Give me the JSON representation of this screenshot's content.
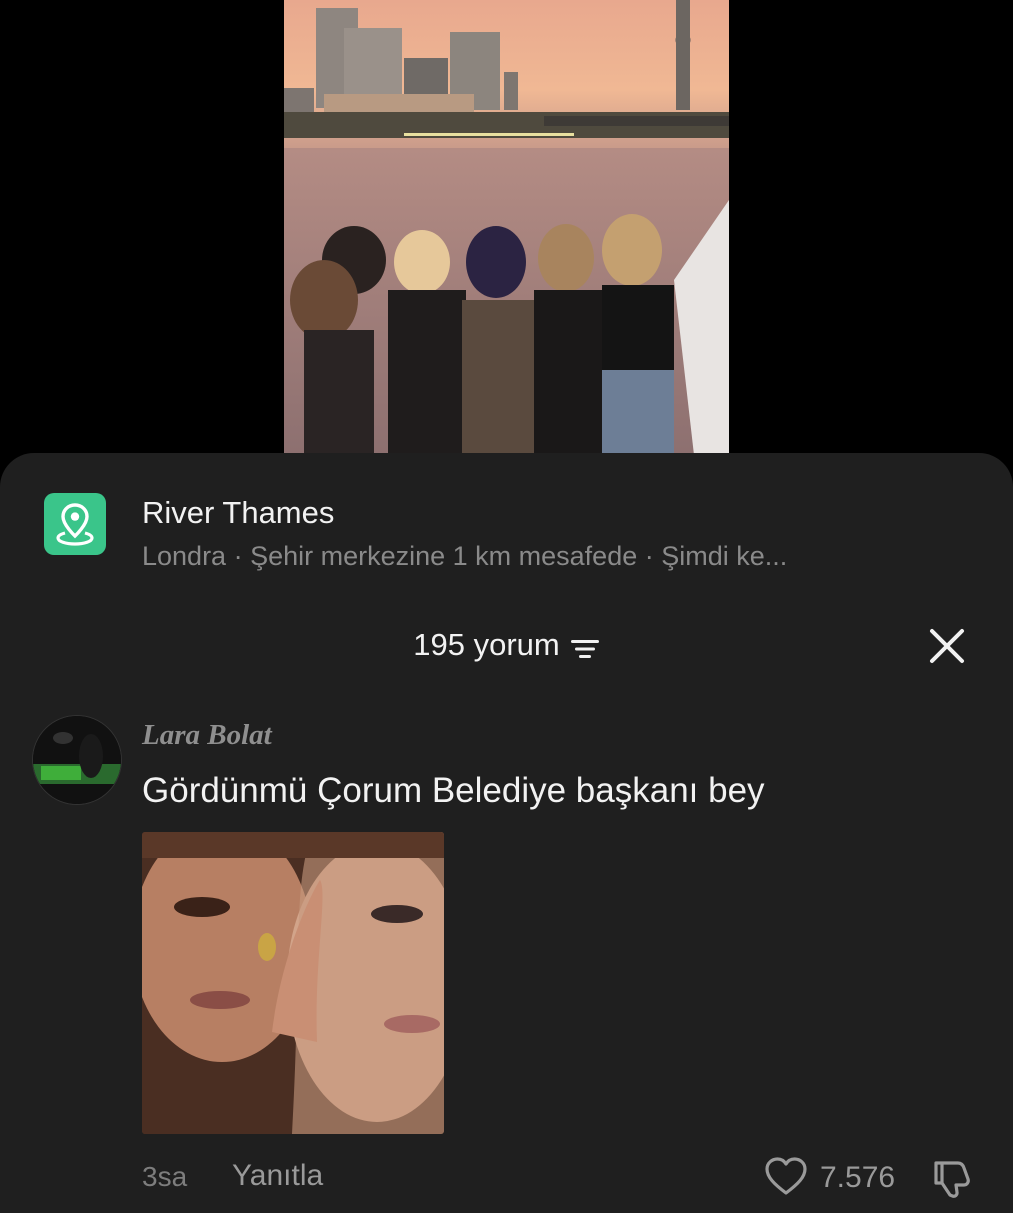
{
  "location": {
    "icon": "location-pin-icon",
    "title": "River Thames",
    "subtitle": "Londra · Şehir merkezine 1 km mesafede · Şimdi ke..."
  },
  "comments_header": {
    "count_label": "195 yorum",
    "filter_icon": "filter-icon",
    "close_icon": "close-icon"
  },
  "comment": {
    "author": "Lara Bolat",
    "text": "Gördünmü Çorum Belediye başkanı bey",
    "time": "3sa",
    "reply_label": "Yanıtla",
    "like_count": "7.576",
    "like_icon": "heart-icon",
    "dislike_icon": "dislike-icon"
  },
  "colors": {
    "sheet_bg": "#1f1f1f",
    "location_icon_bg": "#3ac58a",
    "primary_text": "#f2f2f2",
    "secondary_text": "#8a8a8a"
  }
}
